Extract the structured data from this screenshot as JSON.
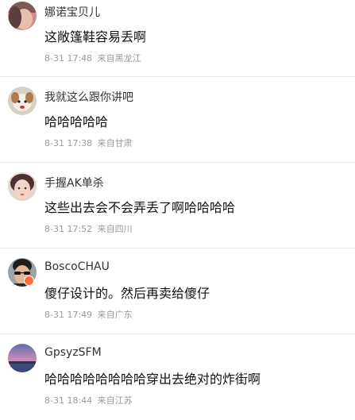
{
  "comments": [
    {
      "username": "娜诺宝贝儿",
      "text": "这敞篷鞋容易丢啊",
      "time": "8-31 17:48",
      "location": "来自黑龙江",
      "avatar_icon": "woman-portrait-avatar"
    },
    {
      "username": "我就这么跟你讲吧",
      "text": "哈哈哈哈哈",
      "time": "8-31 17:38",
      "location": "来自甘肃",
      "avatar_icon": "dog-photo-avatar"
    },
    {
      "username": "手握AK单杀",
      "text": "这些出去会不会弄丢了啊哈哈哈哈",
      "time": "8-31 17:52",
      "location": "来自四川",
      "avatar_icon": "girl-portrait-avatar"
    },
    {
      "username": "BoscoCHAU",
      "text": "傻仔设计的。然后再卖给傻仔",
      "time": "8-31 17:49",
      "location": "来自广东",
      "avatar_icon": "man-sunglasses-avatar",
      "badge_color": "#ff6f3a"
    },
    {
      "username": "GpsyzSFM",
      "text": "哈哈哈哈哈哈哈哈穿出去绝对的炸街啊",
      "time": "8-31 18:44",
      "location": "来自江苏",
      "avatar_icon": "sunset-landscape-avatar"
    }
  ]
}
